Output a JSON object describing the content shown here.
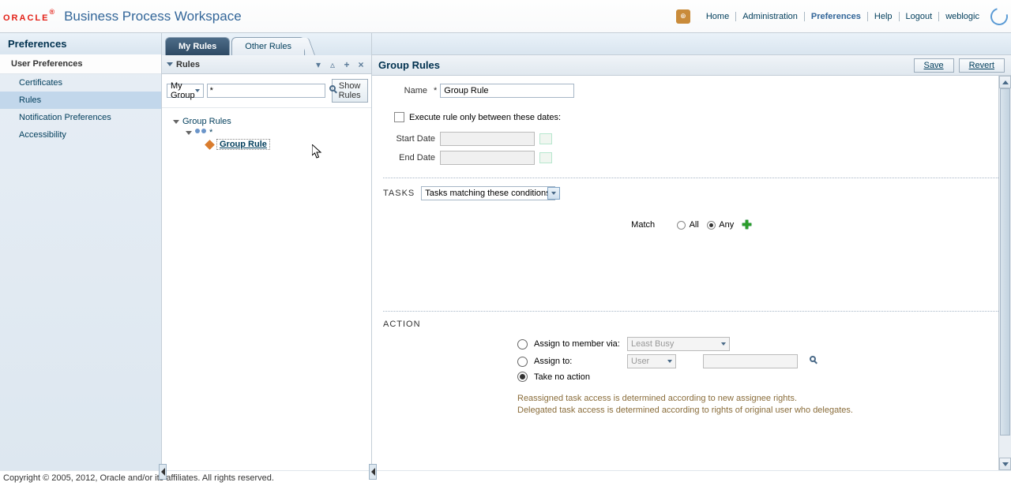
{
  "header": {
    "logo_text": "ORACLE",
    "logo_tm": "®",
    "app_title": "Business Process Workspace",
    "links": {
      "home": "Home",
      "administration": "Administration",
      "preferences": "Preferences",
      "help": "Help",
      "logout": "Logout",
      "user": "weblogic"
    }
  },
  "sidebar": {
    "title": "Preferences",
    "section": "User Preferences",
    "items": [
      "Certificates",
      "Rules",
      "Notification Preferences",
      "Accessibility"
    ],
    "selected_index": 1
  },
  "tabs": {
    "my_rules": "My Rules",
    "other_rules": "Other Rules",
    "active": "my_rules"
  },
  "rules_panel": {
    "title": "Rules",
    "group_select": "My Group",
    "filter_value": "*",
    "show_rules_btn": "Show Rules",
    "tree": {
      "root": "Group Rules",
      "group_star": "*",
      "rule_name": "Group Rule"
    }
  },
  "group_rules": {
    "title": "Group Rules",
    "save_btn": "Save",
    "revert_btn": "Revert",
    "name_label": "Name",
    "name_value": "Group Rule",
    "execute_between_label": "Execute rule only between these dates:",
    "start_date_label": "Start Date",
    "end_date_label": "End Date",
    "start_date_value": "",
    "end_date_value": "",
    "tasks_label": "TASKS",
    "tasks_select": "Tasks matching these conditions",
    "match_label": "Match",
    "match_all": "All",
    "match_any": "Any",
    "action_label": "ACTION",
    "assign_member": "Assign to member via:",
    "assign_member_select": "Least Busy",
    "assign_to": "Assign to:",
    "assign_to_select": "User",
    "take_no_action": "Take no action",
    "note1": "Reassigned task access is determined according to new assignee rights.",
    "note2": "Delegated task access is determined according to rights of original user who delegates."
  },
  "footer": {
    "copyright": "Copyright © 2005, 2012, Oracle and/or its affiliates. All rights reserved."
  }
}
